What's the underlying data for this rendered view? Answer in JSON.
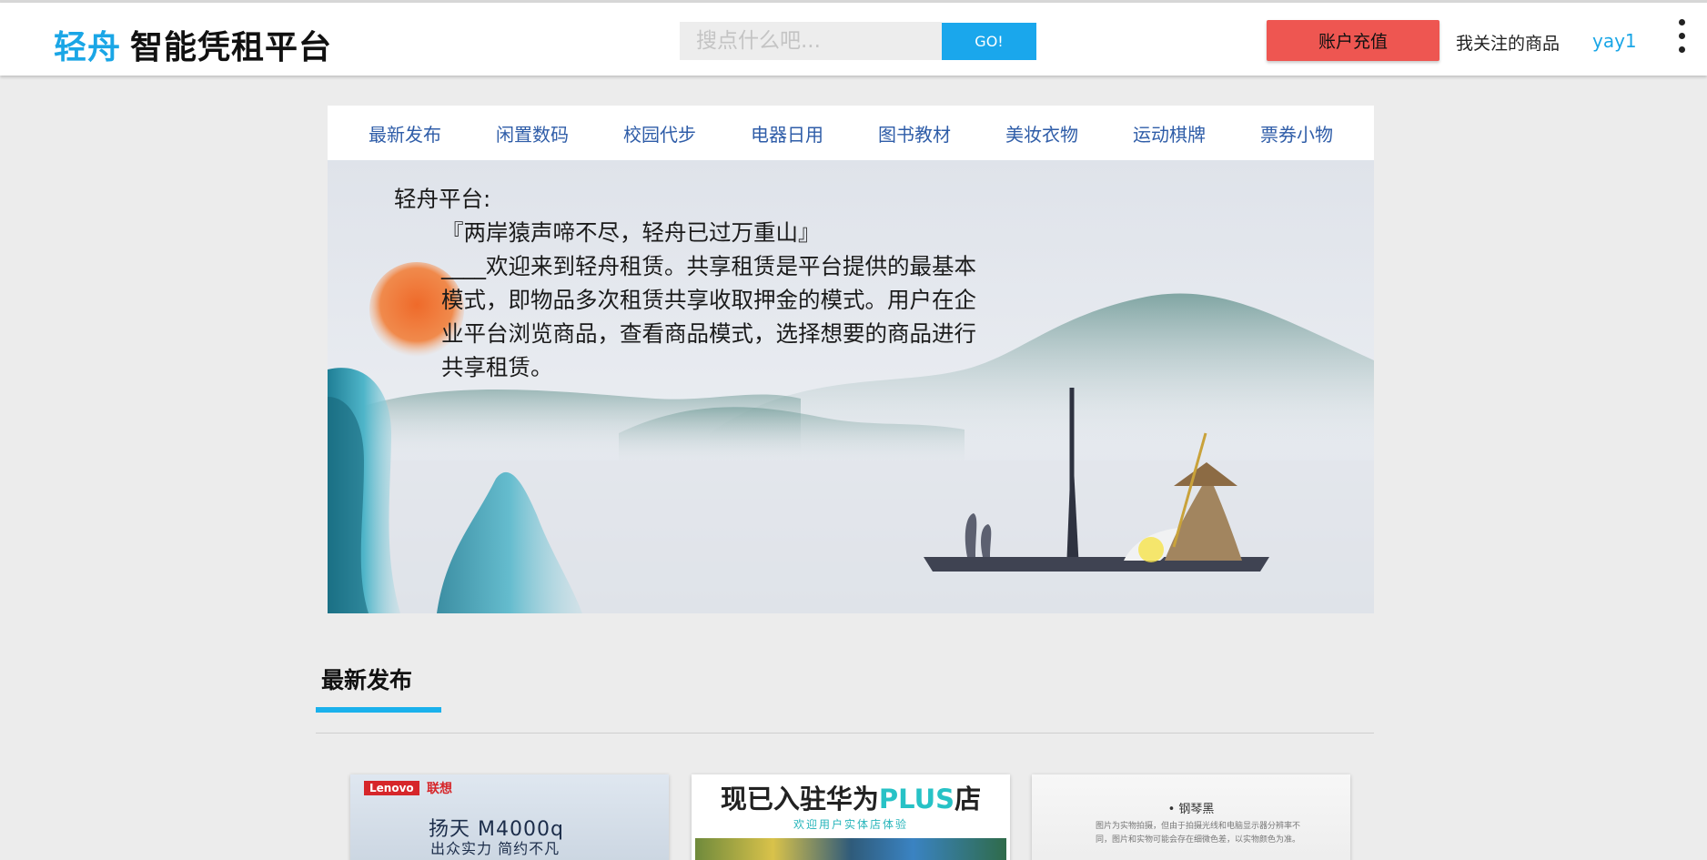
{
  "header": {
    "brand_accent": "轻舟",
    "brand_rest": "智能凭租平台",
    "search_placeholder": "搜点什么吧...",
    "search_button": "GO!",
    "recharge_button": "账户充值",
    "followed_link": "我关注的商品",
    "username": "yay1",
    "more_icon": "more-vertical-icon"
  },
  "categories": [
    "最新发布",
    "闲置数码",
    "校园代步",
    "电器日用",
    "图书教材",
    "美妆衣物",
    "运动棋牌",
    "票券小物"
  ],
  "banner": {
    "heading": "轻舟平台:",
    "quote": "『两岸猿声啼不尽，轻舟已过万重山』",
    "dash": "____",
    "paragraph": "欢迎来到轻舟租赁。共享租赁是平台提供的最基本模式，即物品多次租赁共享收取押金的模式。用户在企业平台浏览商品，查看商品模式，选择想要的商品进行共享租赁。"
  },
  "section": {
    "title": "最新发布"
  },
  "products": [
    {
      "badge": "Lenovo",
      "brand_cn": "联想",
      "model": "扬天 M4000q",
      "slogan": "出众实力 简约不凡"
    },
    {
      "title_prefix": "现已入驻华为",
      "title_plus": "PLUS",
      "title_suffix": "店",
      "subtitle": "欢迎用户实体店体验"
    },
    {
      "color_label": "• 钢琴黑",
      "note": "图片为实物拍摄，但由于拍摄光线和电脑显示器分辨率不同，图片和实物可能会存在细微色差，以实物颜色为准。"
    }
  ],
  "colors": {
    "accent_blue": "#1aa6e6",
    "recharge_red": "#ee5651",
    "category_blue": "#2f5da8",
    "background": "#ececec"
  }
}
